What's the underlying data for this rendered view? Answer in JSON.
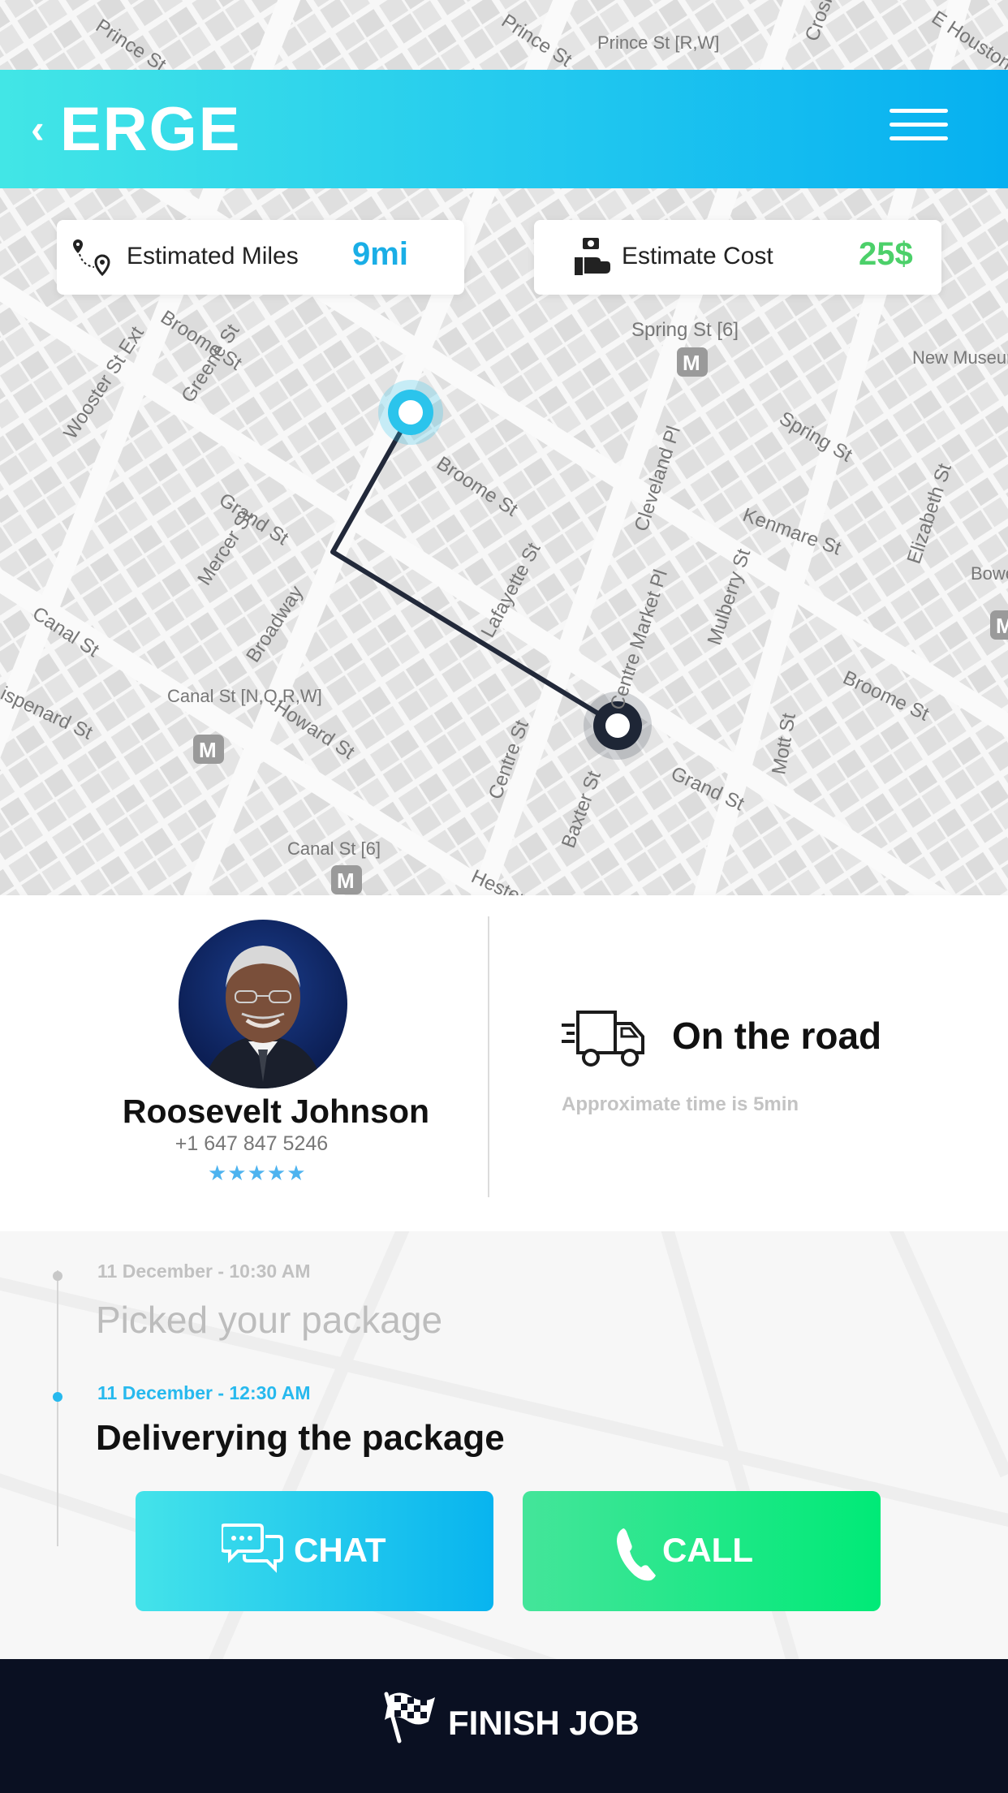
{
  "header": {
    "back_icon": "chevron-left-icon",
    "brand": "ERGE",
    "menu_icon": "hamburger-menu-icon"
  },
  "estimates": {
    "miles_label": "Estimated Miles",
    "miles_value": "9mi",
    "cost_label": "Estimate Cost",
    "cost_value": "25$",
    "miles_color": "#1aaee6",
    "cost_color": "#4cd06a"
  },
  "map": {
    "streets": [
      "Prince St",
      "Prince St [R,W]",
      "Spring St",
      "Spring St [6]",
      "Greene St",
      "Wooster St Ext",
      "Broome St",
      "Grand St",
      "Mercer St",
      "Canal St",
      "Broadway",
      "Lafayette St",
      "Cleveland Pl",
      "Kenmare St",
      "Elizabeth St",
      "Mulberry St",
      "Centre Market Pl",
      "Howard St",
      "Canal St [N,Q,R,W]",
      "Centre St",
      "Baxter St",
      "Mott St",
      "Hester St",
      "Canal St [6]",
      "Lispenard St",
      "New Museum of Contemporary",
      "Bowery [J,M]",
      "E Houston St",
      "Crosby St"
    ],
    "route_start_color": "#2bc4ec",
    "route_end_color": "#1e2636"
  },
  "driver": {
    "name": "Roosevelt  Johnson",
    "phone": "+1 647 847 5246",
    "stars": "★★★★★",
    "rating": 4.5
  },
  "status": {
    "icon": "delivery-truck-icon",
    "title": "On the road",
    "subtitle": "Approximate time is 5min"
  },
  "timeline": [
    {
      "date": "11 December - 10:30 AM",
      "title": "Picked your package",
      "active": false
    },
    {
      "date": "11 December - 12:30 AM",
      "title": "Deliverying the package",
      "active": true
    }
  ],
  "actions": {
    "chat_label": "CHAT",
    "chat_icon": "chat-bubbles-icon",
    "call_label": "CALL",
    "call_icon": "phone-icon"
  },
  "footer": {
    "label": "FINISH JOB",
    "icon": "checkered-flag-icon"
  }
}
